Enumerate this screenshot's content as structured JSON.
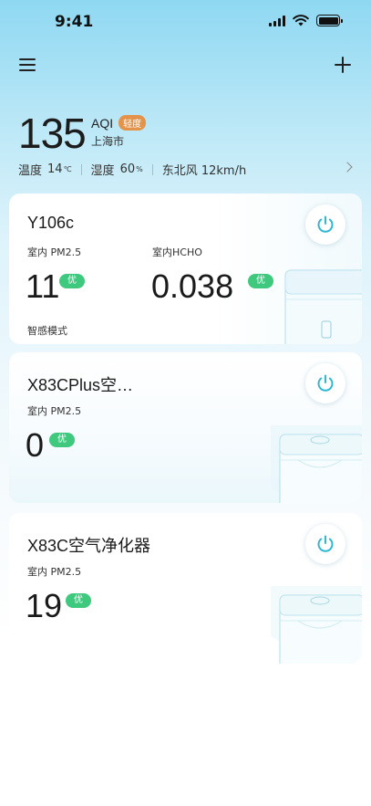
{
  "status_bar": {
    "time": "9:41"
  },
  "weather": {
    "aqi_value": "135",
    "aqi_label": "AQI",
    "aqi_level": "轻度",
    "city": "上海市",
    "temp_label": "温度",
    "temp_value": "14",
    "temp_unit": "℃",
    "humidity_label": "湿度",
    "humidity_value": "60",
    "humidity_unit": "%",
    "wind": "东北风 12km/h"
  },
  "devices": [
    {
      "name": "Y106c",
      "metrics": [
        {
          "label": "室内 PM2.5",
          "value": "11",
          "grade": "优"
        },
        {
          "label": "室内HCHO",
          "value": "0.038",
          "grade": "优"
        }
      ],
      "mode": "智感模式"
    },
    {
      "name": "X83CPlus空…",
      "metrics": [
        {
          "label": "室内 PM2.5",
          "value": "0",
          "grade": "优"
        }
      ]
    },
    {
      "name": "X83C空气净化器",
      "metrics": [
        {
          "label": "室内 PM2.5",
          "value": "19",
          "grade": "优"
        }
      ]
    }
  ],
  "colors": {
    "accent": "#2fb7d4",
    "good_badge": "#3fc97e",
    "aqi_badge": "#e3944a"
  },
  "icons": [
    "menu-icon",
    "add-icon",
    "chevron-right-icon",
    "power-icon"
  ]
}
